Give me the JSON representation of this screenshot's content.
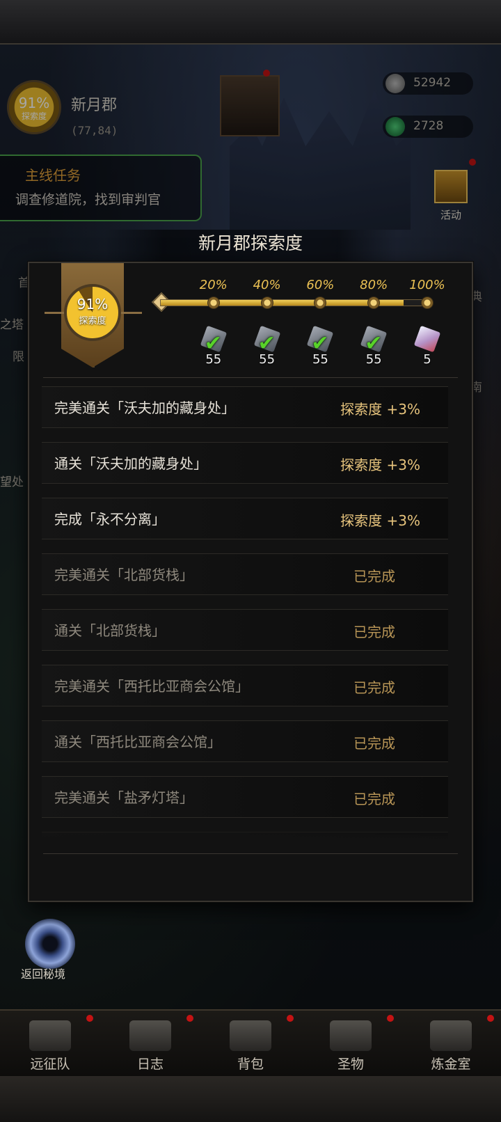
{
  "location": {
    "name": "新月郡",
    "coords": "(77,84)",
    "emblem_percent": "91%",
    "emblem_label": "探索度"
  },
  "resources": {
    "silver": "52942",
    "gems": "2728"
  },
  "quest": {
    "title": "主线任务",
    "desc": "调查修道院，找到审判官"
  },
  "side": {
    "activity_label": "活动"
  },
  "edge_texts": [
    "首",
    "之塔",
    "限",
    "望处",
    "典",
    "南"
  ],
  "modal": {
    "title": "新月郡探索度",
    "progress_percent": "91%",
    "progress_label": "探索度",
    "progress_value": 91,
    "milestones": [
      {
        "label": "20%",
        "reward_count": "55",
        "claimed": true
      },
      {
        "label": "40%",
        "reward_count": "55",
        "claimed": true
      },
      {
        "label": "60%",
        "reward_count": "55",
        "claimed": true
      },
      {
        "label": "80%",
        "reward_count": "55",
        "claimed": true
      },
      {
        "label": "100%",
        "reward_count": "5",
        "claimed": false
      }
    ],
    "tasks": [
      {
        "name": "完美通关「沃夫加的藏身处」",
        "status": "探索度 +3%",
        "done": false
      },
      {
        "name": "通关「沃夫加的藏身处」",
        "status": "探索度 +3%",
        "done": false
      },
      {
        "name": "完成「永不分离」",
        "status": "探索度 +3%",
        "done": false
      },
      {
        "name": "完美通关「北部货栈」",
        "status": "已完成",
        "done": true
      },
      {
        "name": "通关「北部货栈」",
        "status": "已完成",
        "done": true
      },
      {
        "name": "完美通关「西托比亚商会公馆」",
        "status": "已完成",
        "done": true
      },
      {
        "name": "通关「西托比亚商会公馆」",
        "status": "已完成",
        "done": true
      },
      {
        "name": "完美通关「盐矛灯塔」",
        "status": "已完成",
        "done": true
      },
      {
        "name": "通关「盐矛灯塔」",
        "status": "已完成",
        "done": true
      }
    ]
  },
  "portal_label": "返回秘境",
  "nav": [
    {
      "label": "远征队",
      "icon": "helmet-icon"
    },
    {
      "label": "日志",
      "icon": "journal-icon"
    },
    {
      "label": "背包",
      "icon": "backpack-icon"
    },
    {
      "label": "圣物",
      "icon": "relic-icon"
    },
    {
      "label": "炼金室",
      "icon": "alchemy-icon"
    }
  ],
  "colors": {
    "accent_gold": "#ecc254",
    "claimed_check": "#58d229",
    "notification": "#c41313",
    "quest_border": "#4aa34a"
  }
}
